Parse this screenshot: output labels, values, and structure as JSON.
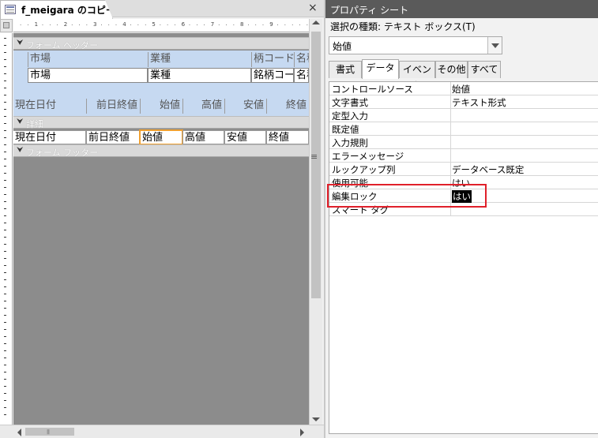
{
  "document_tab": {
    "title": "f_meigara のコピー",
    "close_glyph": "×"
  },
  "ruler": {
    "ticks": [
      "1",
      "2",
      "3",
      "4",
      "5",
      "6",
      "7",
      "8",
      "9"
    ]
  },
  "sections": {
    "form_header": "フォーム ヘッダー",
    "detail": "詳細",
    "form_footer": "フォーム フッター"
  },
  "header_controls": {
    "top_labels": [
      "市場",
      "業種",
      "柄コード",
      "名称"
    ],
    "top_boxes": [
      "市場",
      "業種",
      "銘柄コー",
      "名称"
    ],
    "bottom_labels": [
      "現在日付",
      "前日終値",
      "始値",
      "高値",
      "安値",
      "終値"
    ]
  },
  "detail_controls": [
    "現在日付",
    "前日終値",
    "始値",
    "高値",
    "安値",
    "終値"
  ],
  "property_sheet": {
    "title": "プロパティ シート",
    "selection_type": "選択の種類: テキスト ボックス(T)",
    "selected_object": "始値",
    "tabs": [
      "書式",
      "データ",
      "イベント",
      "その他",
      "すべて"
    ],
    "active_tab": "データ",
    "rows": [
      {
        "key": "コントロールソース",
        "value": "始値"
      },
      {
        "key": "文字書式",
        "value": "テキスト形式"
      },
      {
        "key": "定型入力",
        "value": ""
      },
      {
        "key": "既定値",
        "value": ""
      },
      {
        "key": "入力規則",
        "value": ""
      },
      {
        "key": "エラーメッセージ",
        "value": ""
      },
      {
        "key": "ルックアップ列",
        "value": "データベース既定"
      },
      {
        "key": "使用可能",
        "value": "はい"
      },
      {
        "key": "編集ロック",
        "value": "はい"
      },
      {
        "key": "スマート タグ",
        "value": ""
      }
    ],
    "highlight_color": "#e0202a"
  }
}
